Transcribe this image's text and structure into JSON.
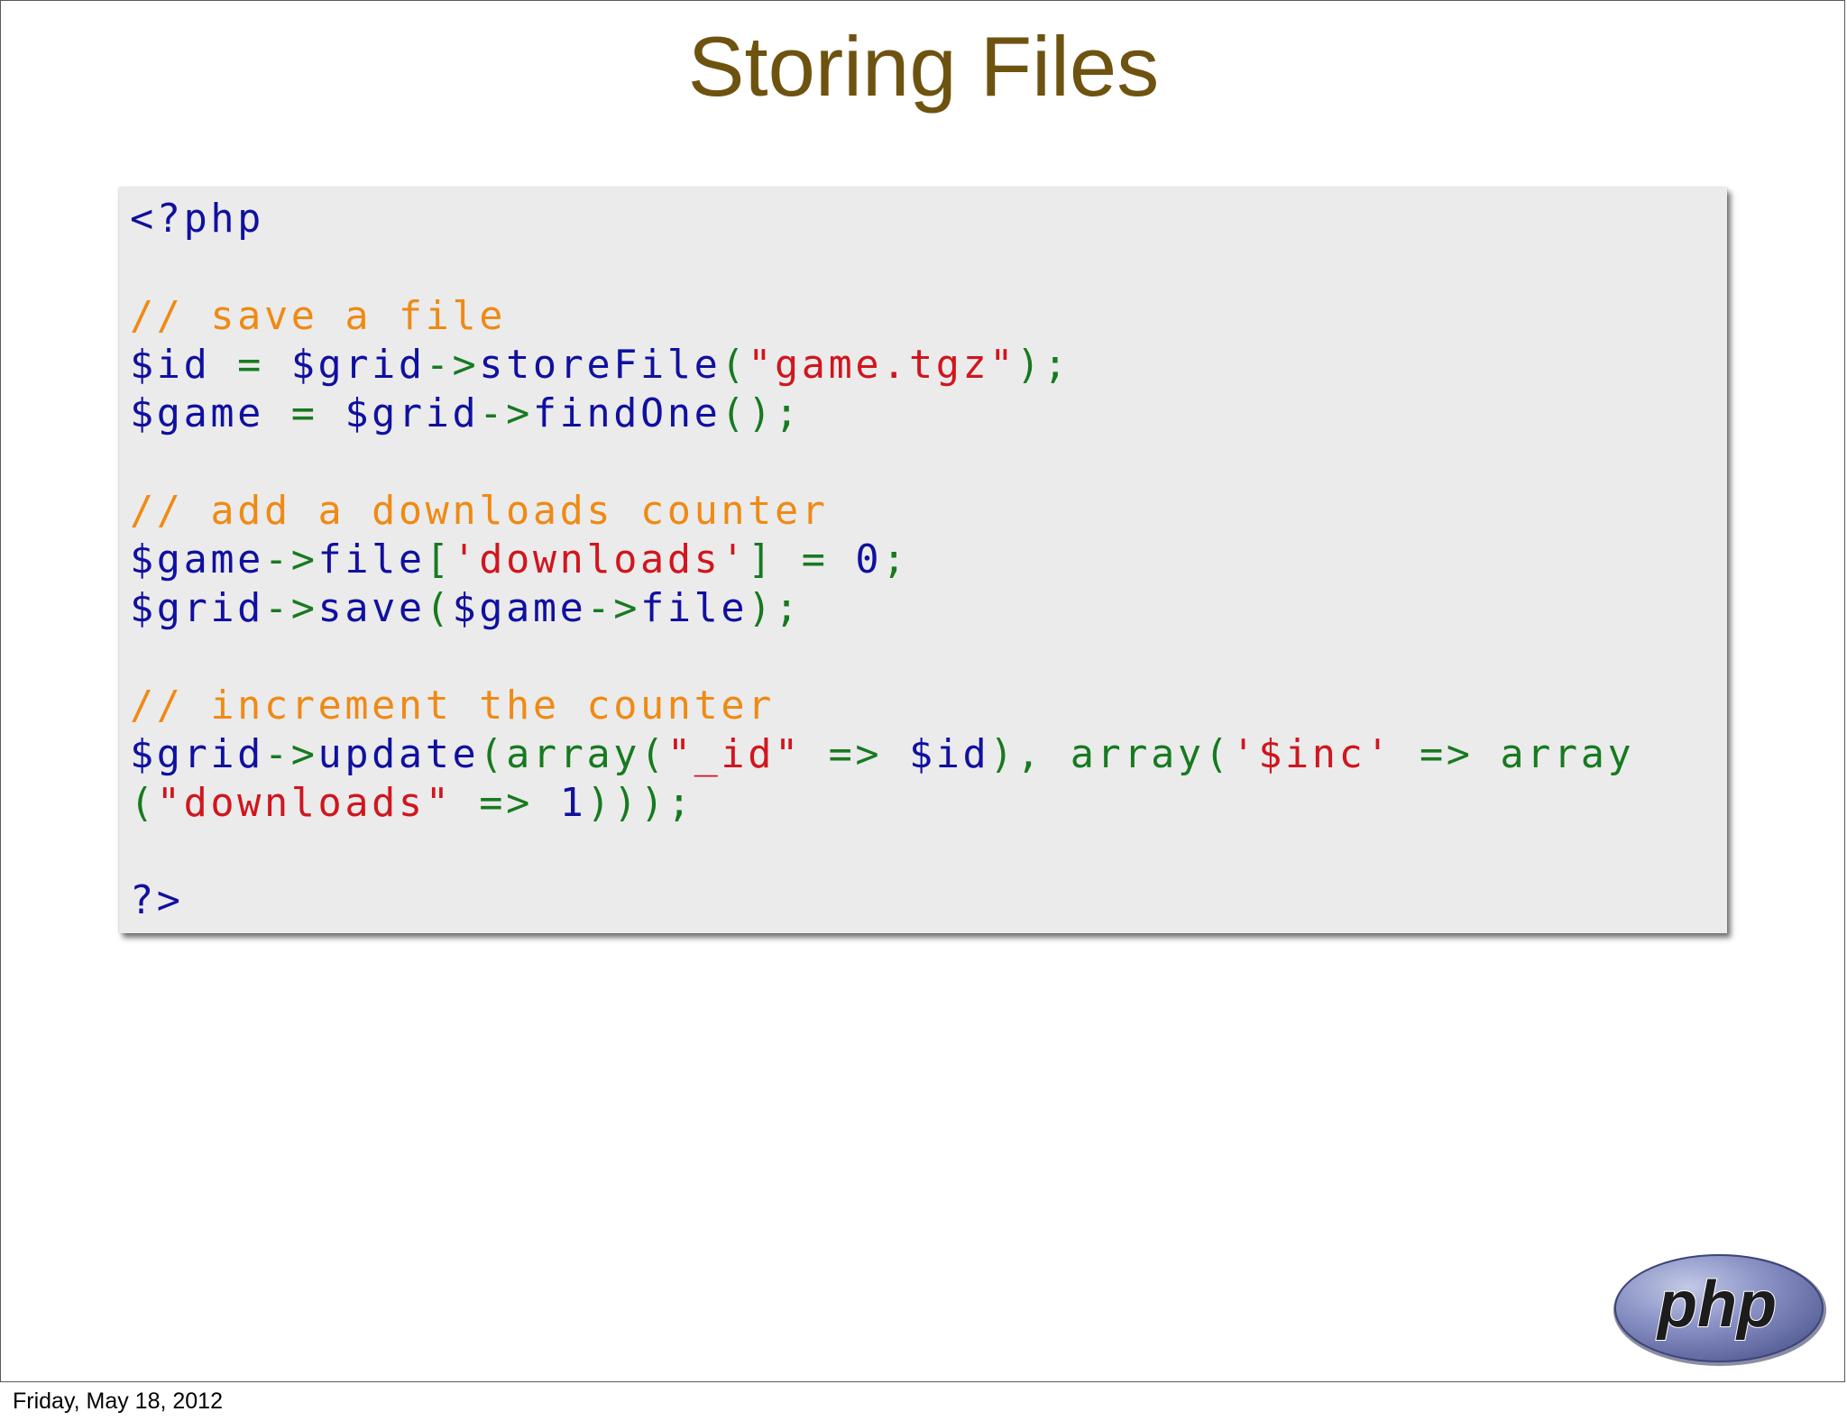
{
  "slide": {
    "title": "Storing Files",
    "footer_date": "Friday, May 18, 2012",
    "logo_text": "php"
  },
  "colors": {
    "title": "#6e5310",
    "code_background": "#ebebeb",
    "keyword": "#1010a0",
    "comment": "#ef8a15",
    "string": "#d0161e",
    "punctuation": "#177a20",
    "logo_fill": "#7a84b8"
  },
  "code": {
    "language": "php",
    "lines": [
      [
        {
          "t": "<?php",
          "k": "kw"
        }
      ],
      [],
      [
        {
          "t": "// save a file",
          "k": "cm"
        }
      ],
      [
        {
          "t": "$id",
          "k": "kw"
        },
        {
          "t": " = ",
          "k": "pn"
        },
        {
          "t": "$grid",
          "k": "kw"
        },
        {
          "t": "->",
          "k": "pn"
        },
        {
          "t": "storeFile",
          "k": "kw"
        },
        {
          "t": "(",
          "k": "pn"
        },
        {
          "t": "\"game.tgz\"",
          "k": "str"
        },
        {
          "t": ");",
          "k": "pn"
        }
      ],
      [
        {
          "t": "$game",
          "k": "kw"
        },
        {
          "t": " = ",
          "k": "pn"
        },
        {
          "t": "$grid",
          "k": "kw"
        },
        {
          "t": "->",
          "k": "pn"
        },
        {
          "t": "findOne",
          "k": "kw"
        },
        {
          "t": "();",
          "k": "pn"
        }
      ],
      [],
      [
        {
          "t": "// add a downloads counter",
          "k": "cm"
        }
      ],
      [
        {
          "t": "$game",
          "k": "kw"
        },
        {
          "t": "->",
          "k": "pn"
        },
        {
          "t": "file",
          "k": "kw"
        },
        {
          "t": "[",
          "k": "pn"
        },
        {
          "t": "'downloads'",
          "k": "str"
        },
        {
          "t": "] = ",
          "k": "pn"
        },
        {
          "t": "0",
          "k": "kw"
        },
        {
          "t": ";",
          "k": "pn"
        }
      ],
      [
        {
          "t": "$grid",
          "k": "kw"
        },
        {
          "t": "->",
          "k": "pn"
        },
        {
          "t": "save",
          "k": "kw"
        },
        {
          "t": "(",
          "k": "pn"
        },
        {
          "t": "$game",
          "k": "kw"
        },
        {
          "t": "->",
          "k": "pn"
        },
        {
          "t": "file",
          "k": "kw"
        },
        {
          "t": ");",
          "k": "pn"
        }
      ],
      [],
      [
        {
          "t": "// increment the counter",
          "k": "cm"
        }
      ],
      [
        {
          "t": "$grid",
          "k": "kw"
        },
        {
          "t": "->",
          "k": "pn"
        },
        {
          "t": "update",
          "k": "kw"
        },
        {
          "t": "(array(",
          "k": "pn"
        },
        {
          "t": "\"_id\"",
          "k": "str"
        },
        {
          "t": " => ",
          "k": "pn"
        },
        {
          "t": "$id",
          "k": "kw"
        },
        {
          "t": "), array(",
          "k": "pn"
        },
        {
          "t": "'$inc'",
          "k": "str"
        },
        {
          "t": " => array",
          "k": "pn"
        }
      ],
      [
        {
          "t": "(",
          "k": "pn"
        },
        {
          "t": "\"downloads\"",
          "k": "str"
        },
        {
          "t": " => ",
          "k": "pn"
        },
        {
          "t": "1",
          "k": "kw"
        },
        {
          "t": ")));",
          "k": "pn"
        }
      ],
      [],
      [
        {
          "t": "?>",
          "k": "kw"
        }
      ]
    ]
  }
}
